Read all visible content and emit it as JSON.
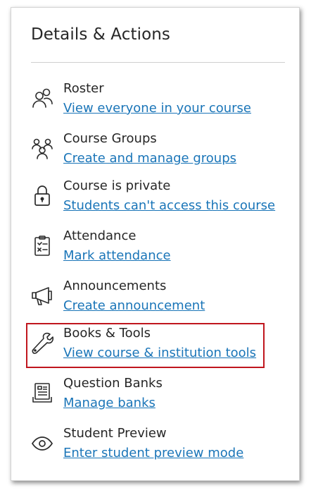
{
  "panel": {
    "title": "Details & Actions"
  },
  "items": [
    {
      "label": "Roster",
      "link": "View everyone in your course",
      "icon": "roster-icon"
    },
    {
      "label": "Course Groups",
      "link": "Create and manage groups",
      "icon": "groups-icon"
    },
    {
      "label": "Course is private",
      "link": "Students can't access this course",
      "icon": "lock-icon"
    },
    {
      "label": "Attendance",
      "link": "Mark attendance",
      "icon": "attendance-icon"
    },
    {
      "label": "Announcements",
      "link": "Create announcement",
      "icon": "megaphone-icon"
    },
    {
      "label": "Books & Tools",
      "link": "View course & institution tools",
      "icon": "wrench-icon"
    },
    {
      "label": "Question Banks",
      "link": "Manage banks",
      "icon": "question-bank-icon"
    },
    {
      "label": "Student Preview",
      "link": "Enter student preview mode",
      "icon": "eye-icon"
    }
  ],
  "colors": {
    "link": "#1a75b8",
    "text": "#262626",
    "highlight": "#c0161e"
  }
}
